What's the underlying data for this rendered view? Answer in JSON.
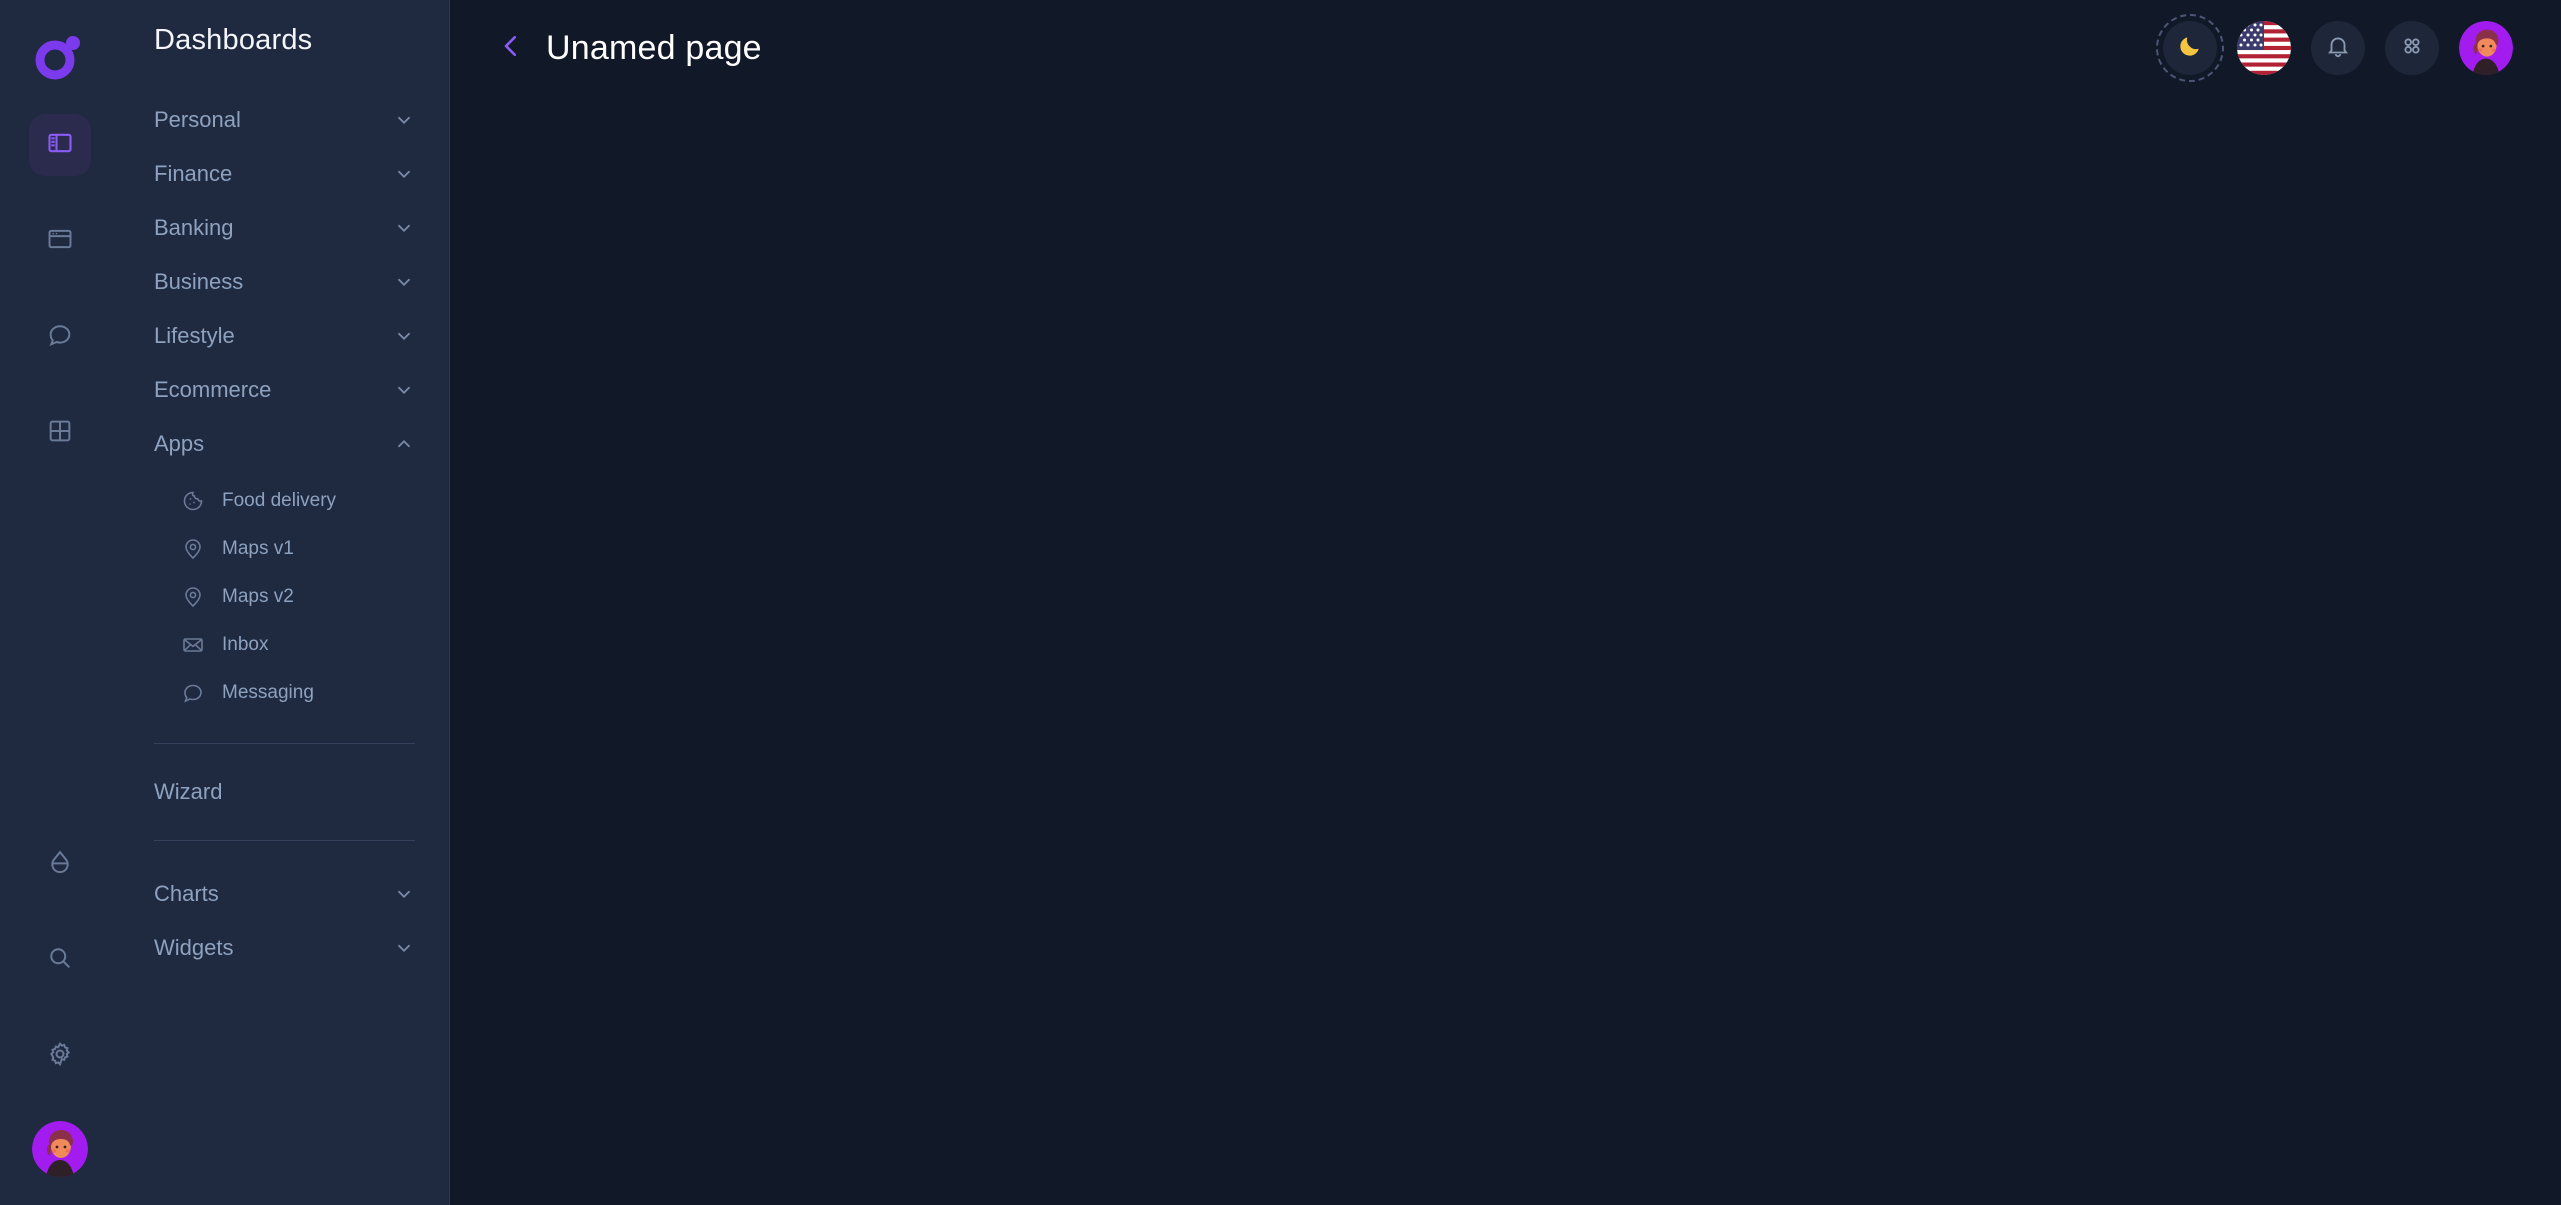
{
  "brand": {
    "logo_icon": "ring-dot-logo",
    "accent": "#7c3aed"
  },
  "colors": {
    "sidebar_bg": "#1f2940",
    "content_bg": "#111827",
    "nav_text": "#8ea2bf",
    "title_text": "#ffffff",
    "divider": "#36415c",
    "active_bg": "#2b2b4d"
  },
  "rail": {
    "items": [
      {
        "icon": "sidebar-layout-icon",
        "active": true
      },
      {
        "icon": "window-icon",
        "active": false
      },
      {
        "icon": "chat-bubble-icon",
        "active": false
      },
      {
        "icon": "grid-icon",
        "active": false
      }
    ],
    "bottom_items": [
      {
        "icon": "water-drop-icon"
      },
      {
        "icon": "search-icon"
      },
      {
        "icon": "gear-icon"
      }
    ],
    "avatar_icon": "user-avatar"
  },
  "sidebar": {
    "title": "Dashboards",
    "groups": [
      {
        "label": "Personal",
        "expanded": false
      },
      {
        "label": "Finance",
        "expanded": false
      },
      {
        "label": "Banking",
        "expanded": false
      },
      {
        "label": "Business",
        "expanded": false
      },
      {
        "label": "Lifestyle",
        "expanded": false
      },
      {
        "label": "Ecommerce",
        "expanded": false
      }
    ],
    "apps": {
      "label": "Apps",
      "expanded": true,
      "items": [
        {
          "label": "Food delivery",
          "icon": "cookie-icon"
        },
        {
          "label": "Maps v1",
          "icon": "map-pin-icon"
        },
        {
          "label": "Maps v2",
          "icon": "map-pin-icon"
        },
        {
          "label": "Inbox",
          "icon": "envelope-icon"
        },
        {
          "label": "Messaging",
          "icon": "chat-bubble-icon"
        }
      ]
    },
    "wizard": {
      "label": "Wizard"
    },
    "bottom_groups": [
      {
        "label": "Charts",
        "expanded": false
      },
      {
        "label": "Widgets",
        "expanded": false
      }
    ]
  },
  "header": {
    "back_icon": "chevron-left-icon",
    "title": "Unamed page",
    "actions": [
      {
        "icon": "moon-icon",
        "name": "dark-mode-toggle"
      },
      {
        "icon": "us-flag-icon",
        "name": "language-selector"
      },
      {
        "icon": "bell-icon",
        "name": "notifications-button"
      },
      {
        "icon": "apps-grid-icon",
        "name": "apps-menu-button"
      },
      {
        "icon": "user-avatar",
        "name": "profile-avatar"
      }
    ]
  }
}
